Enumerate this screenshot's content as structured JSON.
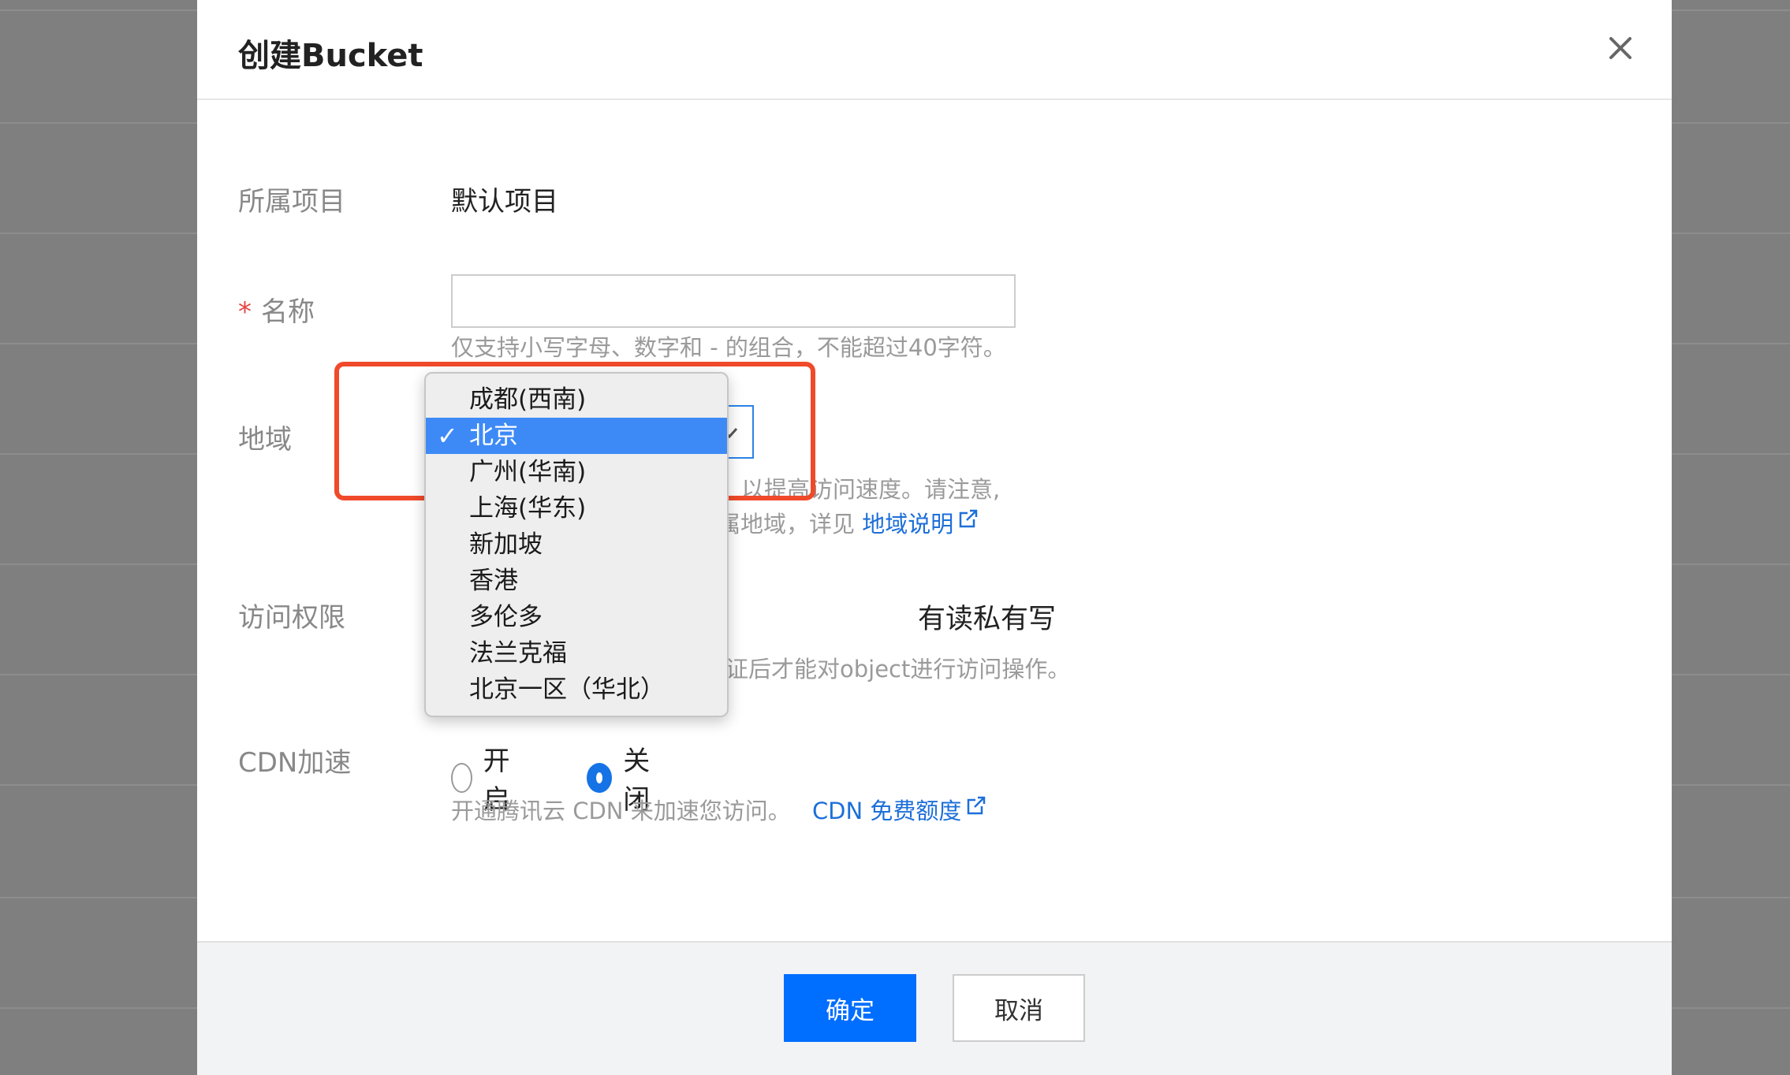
{
  "dialog": {
    "title": "创建Bucket",
    "close_icon": "close-icon"
  },
  "form": {
    "project": {
      "label": "所属项目",
      "value": "默认项目"
    },
    "name": {
      "required_mark": "*",
      "label": "名称",
      "value": "",
      "placeholder": "",
      "hint": "仅支持小写字母、数字和 - 的组合，不能超过40字符。"
    },
    "region": {
      "label": "地域",
      "selected": "北京",
      "hint_line1": "以提高访问速度。请注意,",
      "hint_line2": "属地域，详见",
      "link": "地域说明",
      "options": [
        "成都(西南)",
        "北京",
        "广州(华南)",
        "上海(华东)",
        "新加坡",
        "香港",
        "多伦多",
        "法兰克福",
        "北京一区（华北）"
      ],
      "check_mark": "✓"
    },
    "acl": {
      "label": "访问权限",
      "value_visible": "有读私有写",
      "hint": "证后才能对object进行访问操作。"
    },
    "cdn": {
      "label": "CDN加速",
      "options": [
        "开启",
        "关闭"
      ],
      "selected": "关闭",
      "hint": "开通腾讯云 CDN 来加速您访问。",
      "link": "CDN 免费额度"
    }
  },
  "footer": {
    "confirm_label": "确定",
    "cancel_label": "取消"
  },
  "colors": {
    "primary": "#006eff",
    "link": "#1d6fd9",
    "highlight": "#f04a2a",
    "dropdown_selected": "#3d8af7"
  }
}
